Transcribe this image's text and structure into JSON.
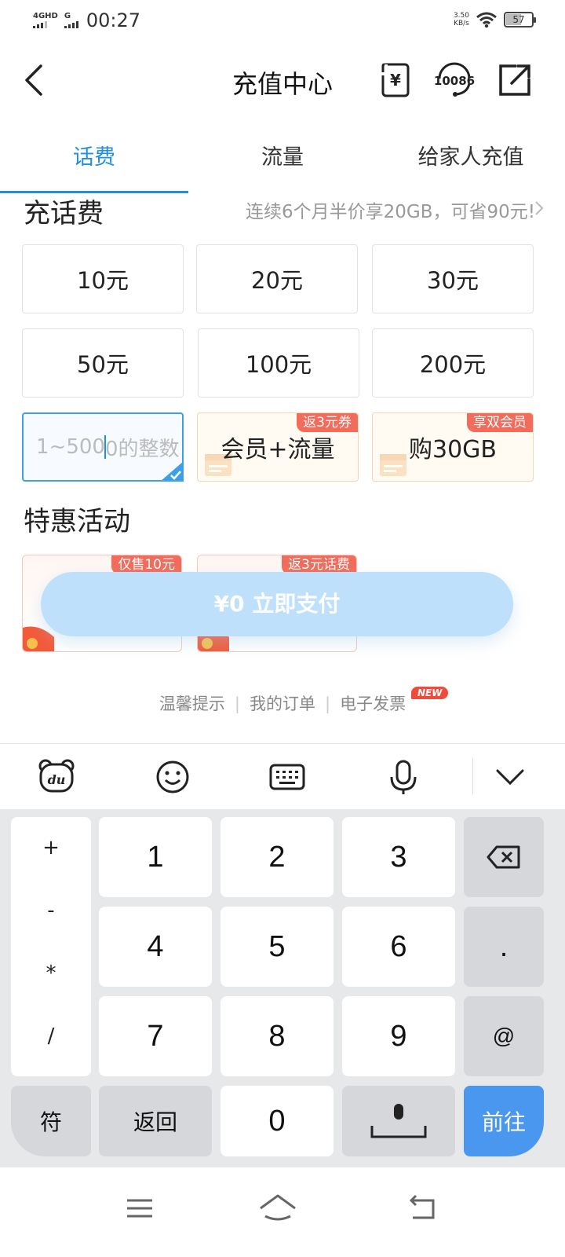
{
  "status_bar": {
    "net1": "4GHD",
    "net2": "G",
    "time": "00:27",
    "speed_value": "3.50",
    "speed_unit": "KB/s",
    "battery": "57"
  },
  "header": {
    "title": "充值中心",
    "back_icon": "chevron-left-icon",
    "icons": [
      "yuan-bill-icon",
      "customer-service-10086-icon",
      "share-icon"
    ],
    "service_number": "10086"
  },
  "tabs": [
    {
      "label": "话费",
      "active": true
    },
    {
      "label": "流量",
      "active": false
    },
    {
      "label": "给家人充值",
      "active": false
    }
  ],
  "recharge": {
    "title": "充话费",
    "promo_text": "连续6个月半价享20GB，可省90元!",
    "amounts": [
      "10元",
      "20元",
      "30元",
      "50元",
      "100元",
      "200元"
    ],
    "custom_input_typed": "1~500",
    "custom_input_rest": "0的整数",
    "member_card": {
      "label": "会员+流量",
      "tag": "返3元券"
    },
    "data_card": {
      "label": "购30GB",
      "tag": "享双会员"
    }
  },
  "activities": {
    "title": "特惠活动",
    "items": [
      {
        "tag": "仅售10元"
      },
      {
        "tag": "返3元话费"
      }
    ]
  },
  "pay_button": {
    "label": "¥0  立即支付"
  },
  "footer_links": {
    "tips": "温馨提示",
    "orders": "我的订单",
    "invoice": "电子发票",
    "new_badge": "NEW"
  },
  "keyboard": {
    "toolbar": [
      "du-bear-icon",
      "emoji-icon",
      "keyboard-icon",
      "microphone-icon",
      "chevron-down-icon"
    ],
    "symbols": [
      "+",
      "-",
      "*",
      "/"
    ],
    "digits": [
      "1",
      "2",
      "3",
      "4",
      "5",
      "6",
      "7",
      "8",
      "9",
      "0"
    ],
    "dot": ".",
    "at": "@",
    "fu": "符",
    "back": "返回",
    "go": "前往",
    "backspace_icon": "backspace-icon",
    "space_icon": "space-mic-icon"
  },
  "navbar": {
    "icons": [
      "menu-icon",
      "home-icon",
      "back-icon"
    ]
  }
}
